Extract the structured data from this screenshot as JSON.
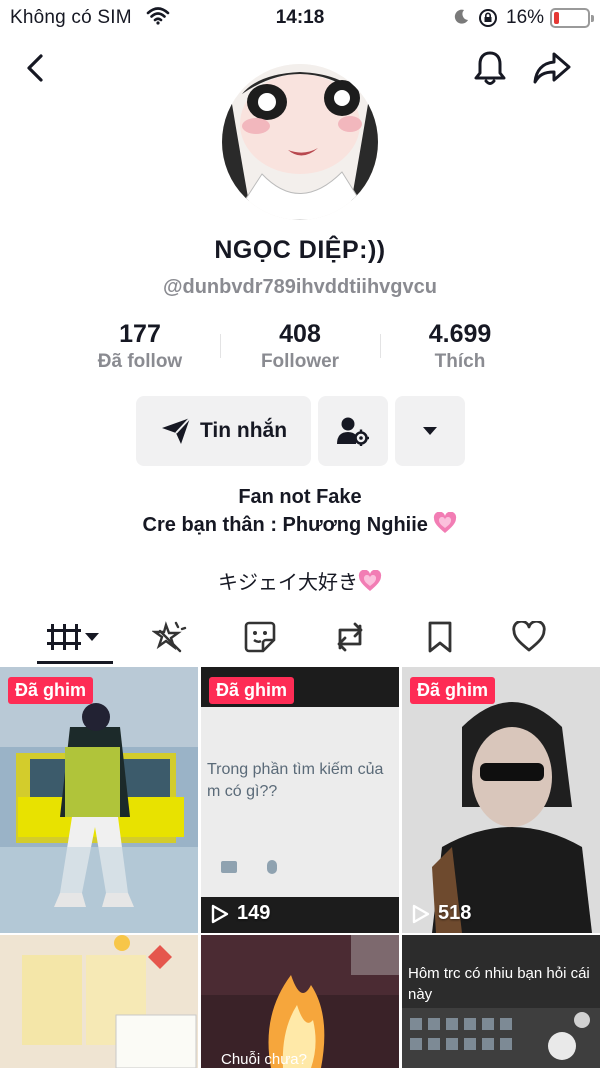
{
  "status_bar": {
    "carrier": "Không có SIM",
    "time": "14:18",
    "battery_percent": "16%",
    "battery_level": 0.16,
    "battery_color": "#e53935"
  },
  "nav": {
    "back_icon": "chevron-left-icon",
    "bell_icon": "bell-icon",
    "share_icon": "share-arrow-icon"
  },
  "profile": {
    "name": "NGỌC DIỆP:))",
    "handle": "@dunbvdr789ihvddtiihvgvcu"
  },
  "stats": [
    {
      "value": "177",
      "label": "Đã follow"
    },
    {
      "value": "408",
      "label": "Follower"
    },
    {
      "value": "4.699",
      "label": "Thích"
    }
  ],
  "actions": {
    "message_label": "Tin nhắn",
    "friend_icon": "person-gear-icon",
    "more_icon": "caret-down-icon"
  },
  "bio": {
    "line1": "Fan not Fake",
    "line2": "Cre bạn thân : Phương Nghiie",
    "line3": "キジェイ大好き"
  },
  "tabs": [
    "videos-grid-icon",
    "sparkle-icon",
    "sticker-icon",
    "repost-icon",
    "bookmark-icon",
    "heart-outline-icon"
  ],
  "videos": [
    {
      "pinned": "Đã ghim",
      "views": ""
    },
    {
      "pinned": "Đã ghim",
      "views": "149",
      "caption": "Trong phần tìm kiếm của m có gì??"
    },
    {
      "pinned": "Đã ghim",
      "views": "518"
    },
    {
      "views": ""
    },
    {
      "views": "",
      "caption": "Chuỗi chưa?"
    },
    {
      "views": "",
      "caption": "Hôm trc có nhiu bạn hỏi cái này"
    }
  ],
  "colors": {
    "accent": "#fe2c55",
    "text": "#161823",
    "muted": "#8a8b91",
    "button_bg": "#f1f1f2"
  }
}
